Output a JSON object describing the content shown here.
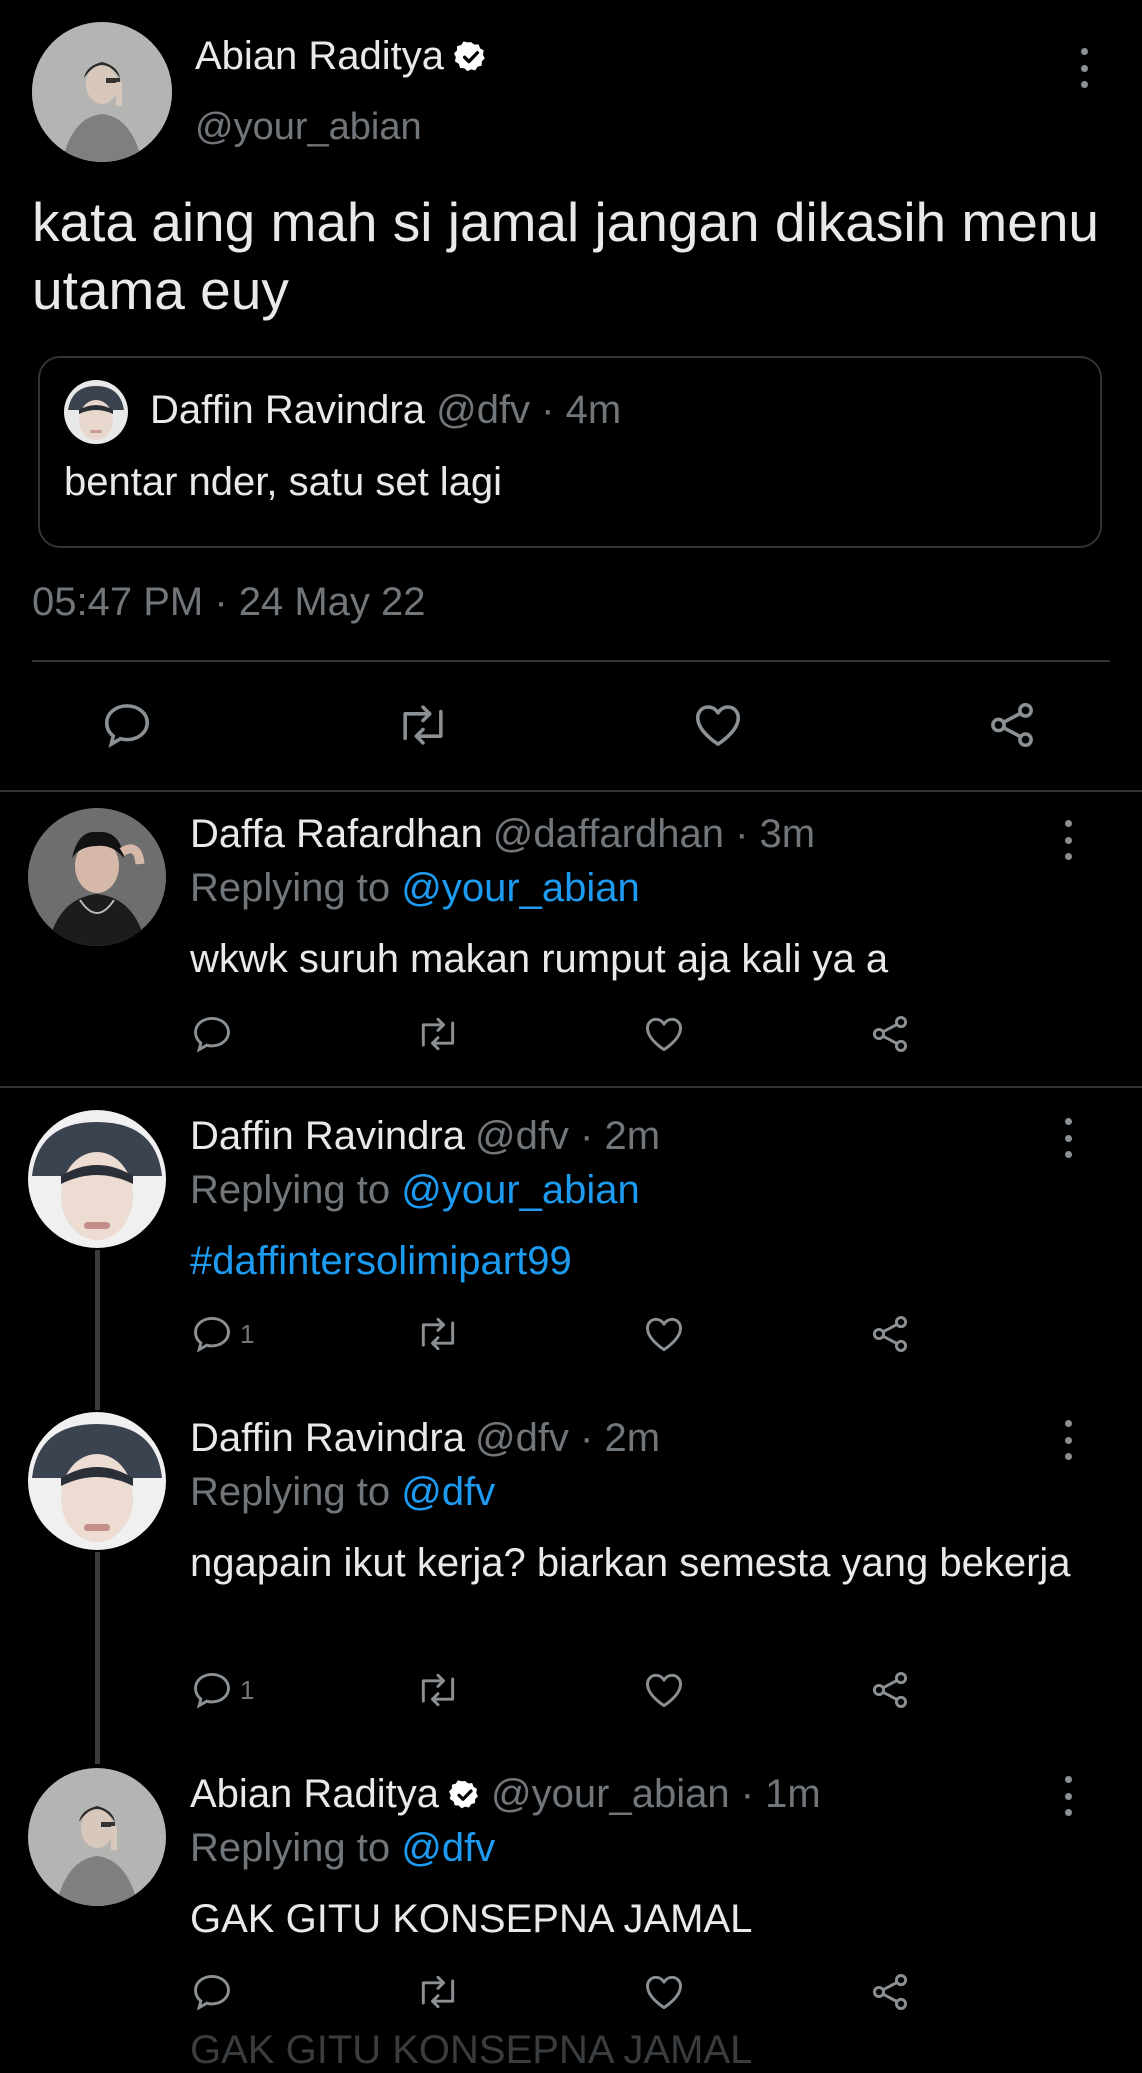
{
  "main_tweet": {
    "name": "Abian Raditya",
    "handle": "@your_abian",
    "text": "kata aing mah si jamal jangan dikasih menu utama euy",
    "quote": {
      "name": "Daffin Ravindra",
      "meta": "@dfv · 4m",
      "text": "bentar nder, satu set lagi"
    },
    "timestamp": "05:47 PM · 24 May 22"
  },
  "replies": [
    {
      "name": "Daffa Rafardhan",
      "meta": "@daffardhan · 3m",
      "replying_prefix": "Replying to",
      "replying_to": "@your_abian",
      "text": "wkwk suruh makan rumput aja kali ya a",
      "reply_count": ""
    },
    {
      "name": "Daffin Ravindra",
      "meta": "@dfv · 2m",
      "replying_prefix": "Replying to",
      "replying_to": "@your_abian",
      "text": "#daffintersolimipart99",
      "reply_count": "1"
    },
    {
      "name": "Daffin Ravindra",
      "meta": "@dfv · 2m",
      "replying_prefix": "Replying to",
      "replying_to": "@dfv",
      "text": "ngapain ikut kerja? biarkan semesta yang bekerja",
      "reply_count": "1"
    },
    {
      "name": "Abian Raditya",
      "meta": "@your_abian · 1m",
      "replying_prefix": "Replying to",
      "replying_to": "@dfv",
      "text": "GAK GITU KONSEPNA JAMAL",
      "reply_count": ""
    }
  ],
  "next_preview_text": "GAK GITU KONSEPNA JAMAL",
  "colors": {
    "background": "#000000",
    "text": "#e7e9ea",
    "muted": "#71767b",
    "link": "#1d9bf0",
    "divider": "#2f3336"
  },
  "icons": [
    "verified-badge-icon",
    "more-icon",
    "reply-icon",
    "retweet-icon",
    "like-icon",
    "share-icon"
  ]
}
